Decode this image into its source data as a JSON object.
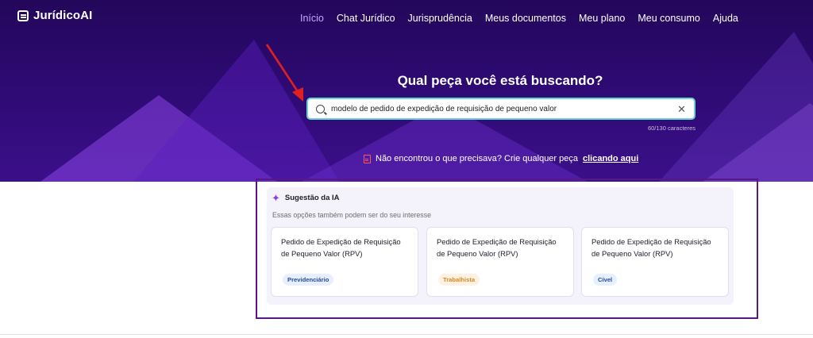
{
  "app": {
    "name": "JurídicoAI"
  },
  "nav": {
    "items": [
      {
        "label": "Início",
        "active": true
      },
      {
        "label": "Chat Jurídico"
      },
      {
        "label": "Jurisprudência"
      },
      {
        "label": "Meus documentos"
      },
      {
        "label": "Meu plano"
      },
      {
        "label": "Meu consumo"
      },
      {
        "label": "Ajuda"
      }
    ]
  },
  "hero": {
    "title": "Qual peça você está buscando?",
    "search_value": "modelo de pedido de expedição de requisição de pequeno valor",
    "char_count": "60/130 caracteres",
    "cta_text": "Não encontrou o que precisava? Crie qualquer peça",
    "cta_link": "clicando aqui"
  },
  "suggestions": {
    "title": "Sugestão da IA",
    "subtitle": "Essas opções também podem ser do seu interesse",
    "cards": [
      {
        "title": "Pedido de Expedição de Requisição de Pequeno Valor (RPV)",
        "tag": "Previdenciário"
      },
      {
        "title": "Pedido de Expedição de Requisição de Pequeno Valor (RPV)",
        "tag": "Trabalhista"
      },
      {
        "title": "Pedido de Expedição de Requisição de Pequeno Valor (RPV)",
        "tag": "Cível"
      }
    ]
  },
  "colors": {
    "accent": "#c9a8ff",
    "hero_bg": "#2d0a72",
    "highlight": "#5a1788",
    "arrow": "#e02020"
  }
}
